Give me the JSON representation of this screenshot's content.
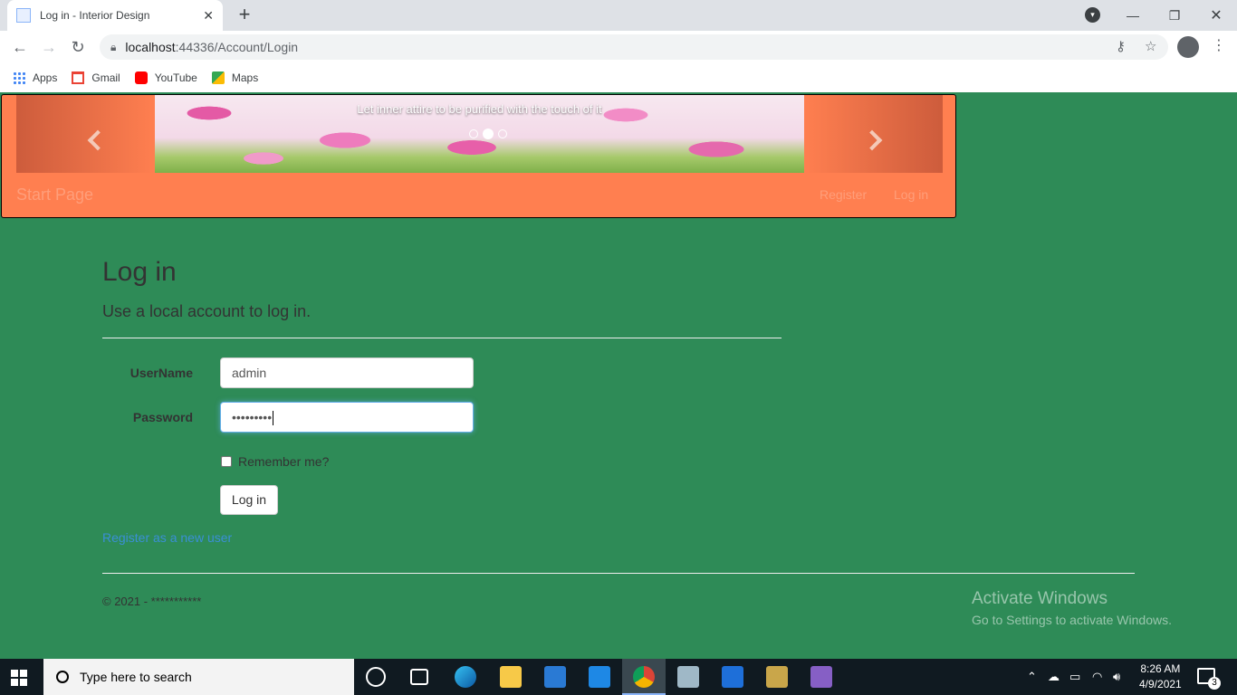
{
  "browser": {
    "tab_title": "Log in - Interior Design",
    "url_host": "localhost",
    "url_path": ":44336/Account/Login",
    "bookmarks": [
      {
        "label": "Apps",
        "icon": "apps-grid-icon"
      },
      {
        "label": "Gmail",
        "icon": "gmail-icon"
      },
      {
        "label": "YouTube",
        "icon": "youtube-icon"
      },
      {
        "label": "Maps",
        "icon": "maps-icon"
      }
    ]
  },
  "header": {
    "carousel_caption": "Let inner attire to be purified with the touch of it",
    "carousel_slides": 3,
    "carousel_active_slide": 2,
    "brand": "Start Page",
    "nav": {
      "register": "Register",
      "login": "Log in"
    },
    "bg_color": "#ff7f50"
  },
  "page": {
    "bg_color": "#2e8b57",
    "title": "Log in",
    "subtitle": "Use a local account to log in.",
    "username_label": "UserName",
    "username_value": "admin",
    "password_label": "Password",
    "password_masked": "•••••••••",
    "remember_label": "Remember me?",
    "remember_checked": false,
    "login_button": "Log in",
    "register_link": "Register as a new user",
    "footer": "© 2021 - ***********"
  },
  "watermark": {
    "line1": "Activate Windows",
    "line2": "Go to Settings to activate Windows."
  },
  "taskbar": {
    "search_placeholder": "Type here to search",
    "time": "8:26 AM",
    "date": "4/9/2021",
    "notification_count": "3"
  }
}
